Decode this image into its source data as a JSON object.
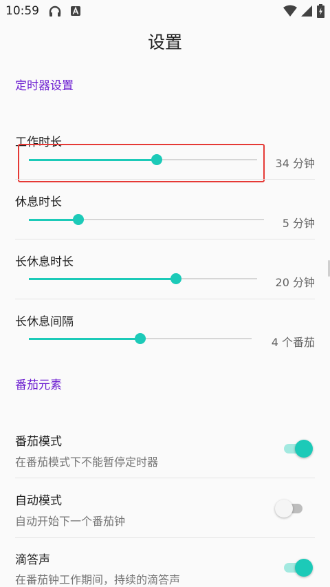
{
  "status_bar": {
    "time": "10:59"
  },
  "page": {
    "title": "设置"
  },
  "sections": {
    "timer": {
      "header": "定时器设置"
    },
    "tomato": {
      "header": "番茄元素"
    }
  },
  "sliders": [
    {
      "title": "工作时长",
      "value_label": "34 分钟",
      "fraction": 0.56
    },
    {
      "title": "休息时长",
      "value_label": "5 分钟",
      "fraction": 0.21
    },
    {
      "title": "长休息时长",
      "value_label": "20 分钟",
      "fraction": 0.645
    },
    {
      "title": "长休息间隔",
      "value_label": "4 个番茄",
      "fraction": 0.5
    }
  ],
  "toggles": [
    {
      "title": "番茄模式",
      "summary": "在番茄模式下不能暂停定时器",
      "on": true
    },
    {
      "title": "自动模式",
      "summary": "自动开始下一个番茄钟",
      "on": false
    },
    {
      "title": "滴答声",
      "summary": "在番茄钟工作期间，持续的滴答声",
      "on": true
    }
  ],
  "colors": {
    "accent": "#1ccab8",
    "section_header": "#6a1bd0",
    "highlight": "#e53935"
  }
}
